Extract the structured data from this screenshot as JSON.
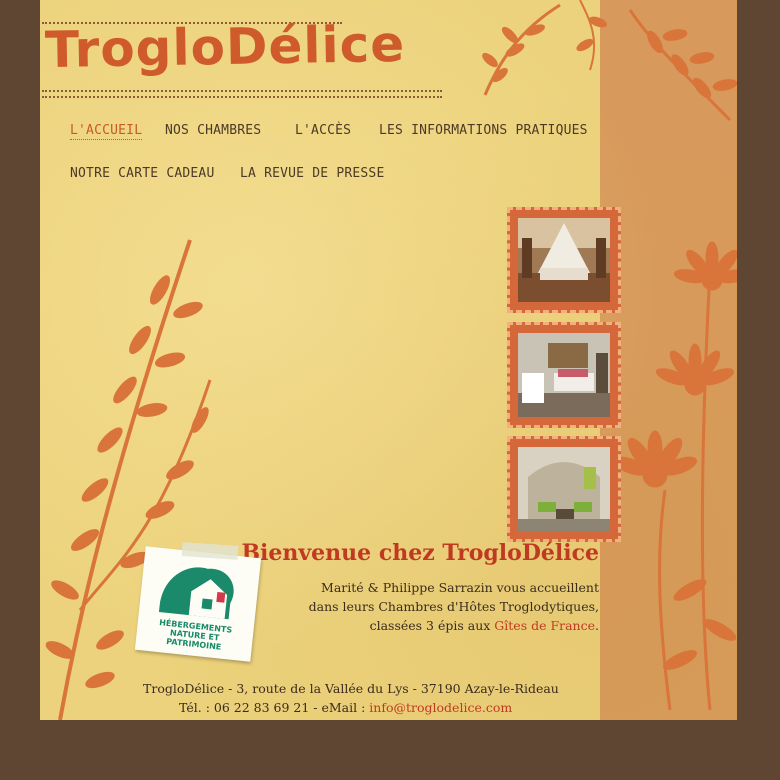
{
  "site": {
    "logo_text": "TrogloDélice"
  },
  "nav": [
    {
      "label": "L'accueil",
      "active": true
    },
    {
      "label": "Nos chambres"
    },
    {
      "label": "L'accès"
    },
    {
      "label": "Les informations pratiques"
    },
    {
      "label": "Notre carte cadeau"
    },
    {
      "label": "La revue de presse"
    }
  ],
  "photos": [
    {
      "alt": "bedroom with canopy bed"
    },
    {
      "alt": "bedroom with twin beds"
    },
    {
      "alt": "troglodyte lounge"
    }
  ],
  "welcome": {
    "title": "Bienvenue chez TrogloDélice",
    "line1": "Marité & Philippe Sarrazin vous accueillent",
    "line2": "dans leurs Chambres d'Hôtes Troglodytiques,",
    "line3_prefix": "classées 3 épis aux ",
    "line3_link": "Gîtes de France",
    "line3_suffix": "."
  },
  "badge": {
    "text": "Hébergements Nature et Patrimoine"
  },
  "footer": {
    "address": "TrogloDélice - 3, route de la Vallée du Lys - 37190 Azay-le-Rideau",
    "phone_label": "Tél. : 06 22 83 69 21 - eMail : ",
    "email": "info@troglodelice.com"
  },
  "colors": {
    "background": "#5e4632",
    "page": "#ecd27c",
    "side_panel": "#d89a5c",
    "accent": "#c85a2a",
    "link": "#c03a22",
    "leaf": "#d9753a"
  }
}
